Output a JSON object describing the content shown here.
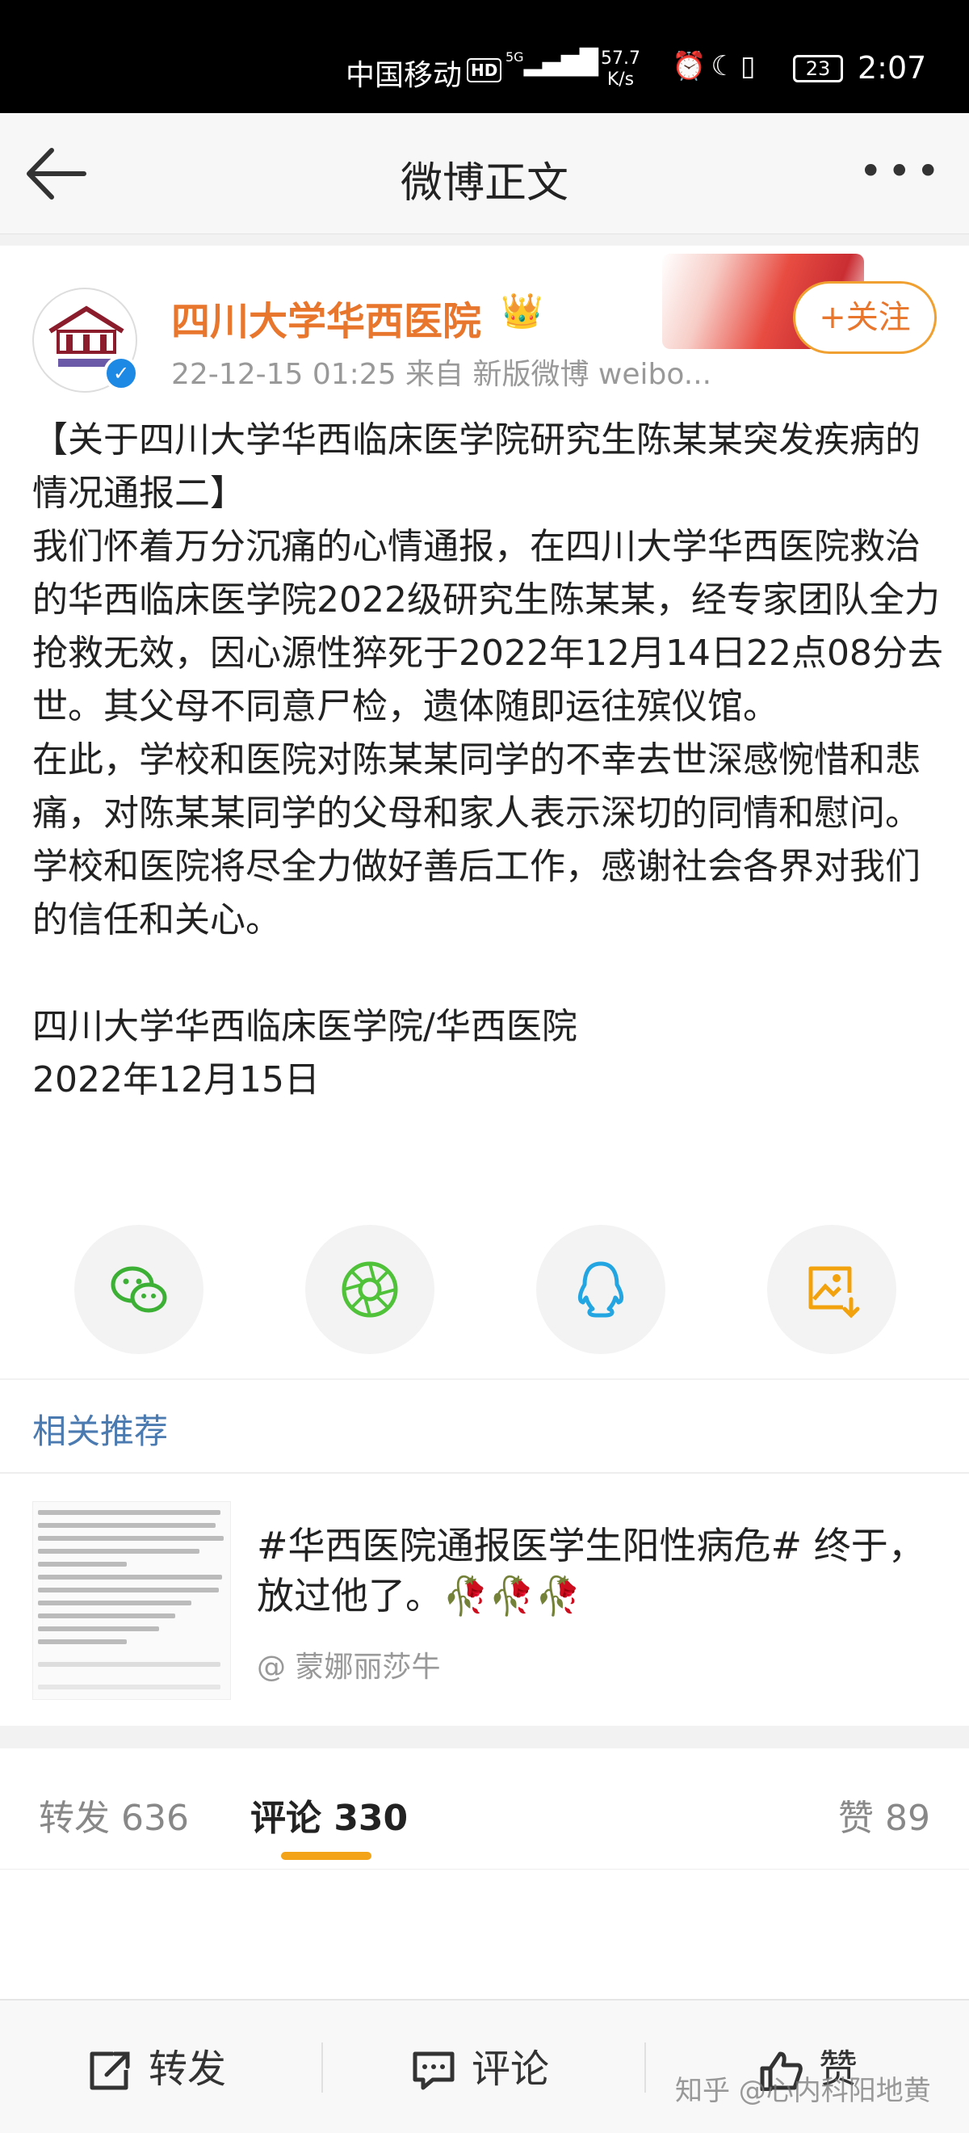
{
  "status_bar": {
    "carrier": "中国移动",
    "hd": "HD",
    "signal": "5G",
    "net_speed": "57.7",
    "net_speed_unit": "K/s",
    "battery": "23",
    "time": "2:07"
  },
  "nav": {
    "title": "微博正文",
    "more": "•••"
  },
  "post": {
    "author": "四川大学华西医院",
    "meta": "22-12-15 01:25  来自 新版微博 weibo...",
    "follow_label": "+关注",
    "verified_mark": "✓",
    "text": "【关于四川大学华西临床医学院研究生陈某某突发疾病的情况通报二】\n我们怀着万分沉痛的心情通报，在四川大学华西医院救治的华西临床医学院2022级研究生陈某某，经专家团队全力抢救无效，因心源性猝死于2022年12月14日22点08分去世。其父母不同意尸检，遗体随即运往殡仪馆。\n在此，学校和医院对陈某某同学的不幸去世深感惋惜和悲痛，对陈某某同学的父母和家人表示深切的同情和慰问。学校和医院将尽全力做好善后工作，感谢社会各界对我们的信任和关心。\n\n四川大学华西临床医学院/华西医院\n2022年12月15日"
  },
  "share": {
    "icons": [
      "wechat-icon",
      "moments-icon",
      "qq-icon",
      "save-image-icon"
    ],
    "colors": {
      "wechat": "#3cb034",
      "moments": "#4fc23a",
      "qq": "#23a5e2",
      "save": "#f2a20c"
    }
  },
  "related": {
    "title": "相关推荐",
    "text": "#华西医院通报医学生阳性病危# 终于，放过他了。🥀🥀🥀",
    "author": "@ 蒙娜丽莎牛"
  },
  "tabs": {
    "repost": "转发 636",
    "comment": "评论 330",
    "like": "赞 89"
  },
  "bottom_bar": {
    "repost": "转发",
    "comment": "评论",
    "like": "赞"
  },
  "watermark": "知乎 @心内科阳地黄",
  "colors": {
    "author": "#e8762d",
    "related_title": "#4a7ab0",
    "tab_underline": "#f3a318"
  }
}
